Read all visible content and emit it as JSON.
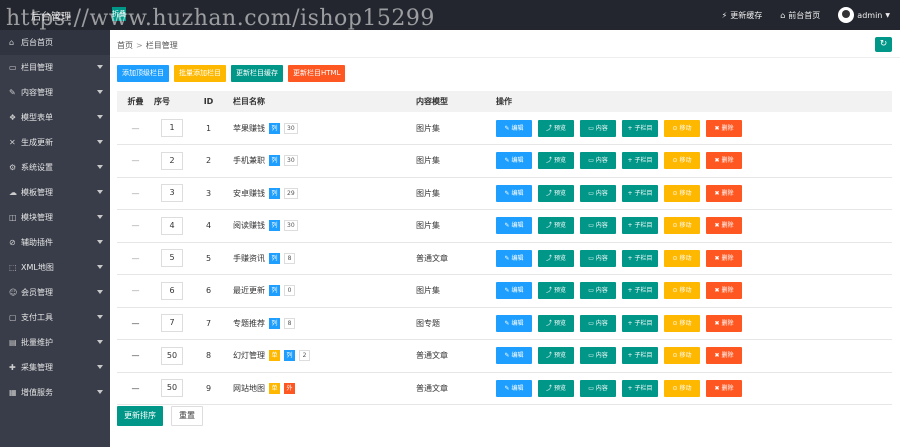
{
  "header": {
    "brand": "后台管理",
    "toggle": "折叠",
    "watermark": "https://www.huzhan.com/ishop15299",
    "update_cache": "更新缓存",
    "front_home": "前台首页",
    "user": "admin"
  },
  "sidebar": {
    "items": [
      {
        "label": "后台首页",
        "icon": "⌂"
      },
      {
        "label": "栏目管理",
        "icon": "▭"
      },
      {
        "label": "内容管理",
        "icon": "✎"
      },
      {
        "label": "模型表单",
        "icon": "❖"
      },
      {
        "label": "生成更新",
        "icon": "✕"
      },
      {
        "label": "系统设置",
        "icon": "⚙"
      },
      {
        "label": "模板管理",
        "icon": "☁"
      },
      {
        "label": "模块管理",
        "icon": "◫"
      },
      {
        "label": "辅助插件",
        "icon": "⊘"
      },
      {
        "label": "XML地图",
        "icon": "⬚"
      },
      {
        "label": "会员管理",
        "icon": "☺"
      },
      {
        "label": "支付工具",
        "icon": "▢"
      },
      {
        "label": "批量维护",
        "icon": "▤"
      },
      {
        "label": "采集管理",
        "icon": "✚"
      },
      {
        "label": "增值服务",
        "icon": "▦"
      }
    ]
  },
  "breadcrumb": {
    "home": "首页",
    "sep": ">",
    "current": "栏目管理"
  },
  "refresh_icon": "↻",
  "toolbar": {
    "add_top": "添加顶级栏目",
    "batch_add": "批量添加栏目",
    "update_cache": "更新栏目缓存",
    "update_html": "更新栏目HTML"
  },
  "table": {
    "headers": [
      "折叠",
      "序号",
      "ID",
      "栏目名称",
      "内容模型",
      "操作"
    ],
    "rows": [
      {
        "fold": "—",
        "order": "1",
        "id": "1",
        "name": "苹果赚钱",
        "tag": "列",
        "tag_color": "blue",
        "count": "30",
        "model": "图片集"
      },
      {
        "fold": "—",
        "order": "2",
        "id": "2",
        "name": "手机兼职",
        "tag": "列",
        "tag_color": "blue",
        "count": "30",
        "model": "图片集"
      },
      {
        "fold": "—",
        "order": "3",
        "id": "3",
        "name": "安卓赚钱",
        "tag": "列",
        "tag_color": "blue",
        "count": "29",
        "model": "图片集"
      },
      {
        "fold": "—",
        "order": "4",
        "id": "4",
        "name": "阅读赚钱",
        "tag": "列",
        "tag_color": "blue",
        "count": "30",
        "model": "图片集"
      },
      {
        "fold": "—",
        "order": "5",
        "id": "5",
        "name": "手赚资讯",
        "tag": "列",
        "tag_color": "blue",
        "count": "8",
        "model": "普通文章"
      },
      {
        "fold": "—",
        "order": "6",
        "id": "6",
        "name": "最近更新",
        "tag": "列",
        "tag_color": "blue",
        "count": "0",
        "model": "图片集"
      },
      {
        "fold": "—",
        "order": "7",
        "id": "7",
        "name": "专题推荐",
        "tag": "列",
        "tag_color": "blue",
        "count": "8",
        "model": "图专题"
      },
      {
        "fold": "—",
        "order": "50",
        "id": "8",
        "name": "幻灯管理",
        "tag": "单",
        "tag_color": "yellow",
        "tag2": "列",
        "count": "2",
        "model": "普通文章"
      },
      {
        "fold": "—",
        "order": "50",
        "id": "9",
        "name": "网站地图",
        "tag": "单",
        "tag_color": "yellow",
        "tag2": "外",
        "count": "",
        "model": "普通文章"
      }
    ],
    "ops": [
      {
        "label": "✎ 编辑",
        "color": "blue"
      },
      {
        "label": "⤴ 预览",
        "color": "green"
      },
      {
        "label": "▭ 内容",
        "color": "green"
      },
      {
        "label": "+ 子栏目",
        "color": "green"
      },
      {
        "label": "⊙ 移动",
        "color": "yellow"
      },
      {
        "label": "✖ 删除",
        "color": "red"
      }
    ]
  },
  "bottom": {
    "save_order": "更新排序",
    "reset": "重置"
  }
}
